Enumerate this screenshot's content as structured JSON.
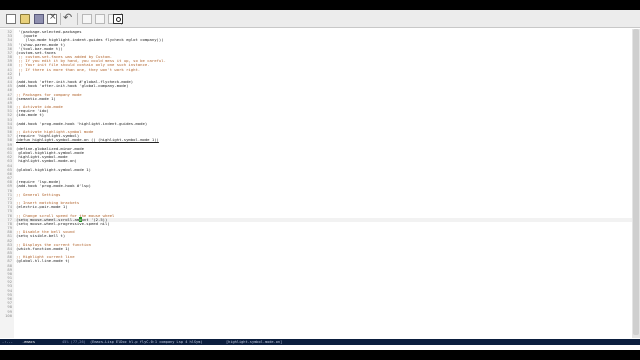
{
  "toolbar": {
    "buttons": [
      {
        "name": "new-file-button",
        "icon": "new-file-icon"
      },
      {
        "name": "open-folder-button",
        "icon": "folder-icon"
      },
      {
        "name": "save-button",
        "icon": "save-icon"
      },
      {
        "name": "close-buffer-button",
        "icon": "close-icon"
      },
      {
        "name": "undo-button",
        "icon": "undo-icon"
      },
      {
        "name": "cut-button",
        "icon": "cut-icon"
      },
      {
        "name": "copy-button",
        "icon": "copy-icon"
      },
      {
        "name": "paste-button",
        "icon": "paste-icon"
      },
      {
        "name": "search-button",
        "icon": "search-icon"
      }
    ]
  },
  "editor": {
    "lines": [
      {
        "n": "32",
        "text": " '(package-selected-packages"
      },
      {
        "n": "33",
        "text": "   (quote"
      },
      {
        "n": "34",
        "text": "    (lsp-mode highlight-indent-guides flycheck eglot company)))"
      },
      {
        "n": "35",
        "text": " '(show-paren-mode t)"
      },
      {
        "n": "36",
        "text": " '(tool-bar-mode t))"
      },
      {
        "n": "37",
        "text": "(custom-set-faces"
      },
      {
        "n": "38",
        "text": " ;; custom-set-faces was added by Custom.",
        "cls": "comment"
      },
      {
        "n": "39",
        "text": " ;; If you edit it by hand, you could mess it up, so be careful.",
        "cls": "comment"
      },
      {
        "n": "40",
        "text": " ;; Your init file should contain only one such instance.",
        "cls": "comment"
      },
      {
        "n": "41",
        "text": " ;; If there is more than one, they won't work right.",
        "cls": "comment"
      },
      {
        "n": "42",
        "text": " )"
      },
      {
        "n": "43",
        "text": ""
      },
      {
        "n": "44",
        "text": "(add-hook 'after-init-hook #'global-flycheck-mode)"
      },
      {
        "n": "45",
        "text": "(add-hook 'after-init-hook 'global-company-mode)"
      },
      {
        "n": "46",
        "text": ""
      },
      {
        "n": "47",
        "text": ";; Packages for company mode",
        "cls": "comment"
      },
      {
        "n": "48",
        "text": "(semantic-mode 1)"
      },
      {
        "n": "49",
        "text": ""
      },
      {
        "n": "50",
        "text": ";; Activate ido-mode",
        "cls": "comment"
      },
      {
        "n": "51",
        "text": "(require 'ido)"
      },
      {
        "n": "52",
        "text": "(ido-mode t)"
      },
      {
        "n": "53",
        "text": ""
      },
      {
        "n": "54",
        "text": "(add-hook 'prog-mode-hook 'highlight-indent-guides-mode)"
      },
      {
        "n": "55",
        "text": ""
      },
      {
        "n": "56",
        "text": ";; Activate highlight-symbol mode",
        "cls": "comment"
      },
      {
        "n": "57",
        "text": "(require 'highlight-symbol)"
      },
      {
        "n": "58",
        "text": "(defun highlight-symbol-mode-on () (highlight-symbol-mode 1))",
        "cls": "highlight-symbol"
      },
      {
        "n": "59",
        "text": ""
      },
      {
        "n": "60",
        "text": "(define-globalized-minor-mode"
      },
      {
        "n": "61",
        "text": " global-highlight-symbol-mode"
      },
      {
        "n": "62",
        "text": " highlight-symbol-mode"
      },
      {
        "n": "63",
        "text": " highlight-symbol-mode-on)"
      },
      {
        "n": "64",
        "text": ""
      },
      {
        "n": "65",
        "text": "(global-highlight-symbol-mode 1)"
      },
      {
        "n": "66",
        "text": ""
      },
      {
        "n": "67",
        "text": ""
      },
      {
        "n": "68",
        "text": "(require 'lsp-mode)"
      },
      {
        "n": "69",
        "text": "(add-hook 'prog-mode-hook #'lsp)"
      },
      {
        "n": "70",
        "text": ""
      },
      {
        "n": "71",
        "text": ";; General Settings",
        "cls": "comment"
      },
      {
        "n": "72",
        "text": ""
      },
      {
        "n": "73",
        "text": ";; Insert matching brackets",
        "cls": "comment"
      },
      {
        "n": "74",
        "text": "(electric-pair-mode 1)"
      },
      {
        "n": "75",
        "text": ""
      },
      {
        "n": "76",
        "text": ";; Change scroll speed for the mouse wheel",
        "cls": "comment"
      },
      {
        "n": "77",
        "text": "(setq mouse-wheel-scroll-amount '(2.5))",
        "cursor": true
      },
      {
        "n": "78",
        "text": "(setq mouse-wheel-progressive-speed nil)"
      },
      {
        "n": "79",
        "text": ""
      },
      {
        "n": "80",
        "text": ";; Disable the bell sound",
        "cls": "comment"
      },
      {
        "n": "81",
        "text": "(setq visible-bell t)"
      },
      {
        "n": "82",
        "text": ""
      },
      {
        "n": "83",
        "text": ";; Displays the current function",
        "cls": "comment"
      },
      {
        "n": "84",
        "text": "(which-function-mode 1)"
      },
      {
        "n": "85",
        "text": ""
      },
      {
        "n": "86",
        "text": ";; Highlight current line",
        "cls": "comment"
      },
      {
        "n": "87",
        "text": "(global-hl-line-mode t)"
      },
      {
        "n": "88",
        "text": ""
      },
      {
        "n": "89",
        "text": ""
      },
      {
        "n": "90",
        "text": ""
      },
      {
        "n": "91",
        "text": ""
      },
      {
        "n": "92",
        "text": ""
      },
      {
        "n": "93",
        "text": ""
      },
      {
        "n": "94",
        "text": ""
      },
      {
        "n": "95",
        "text": ""
      },
      {
        "n": "96",
        "text": ""
      },
      {
        "n": "97",
        "text": ""
      },
      {
        "n": "98",
        "text": ""
      },
      {
        "n": "99",
        "text": ""
      },
      {
        "n": "100",
        "text": ""
      }
    ]
  },
  "modeline": {
    "status": "-:---",
    "buffer": ".emacs",
    "position": "45% (77,26)",
    "modes": "(Emacs-Lisp ElDoc hl-p flyC-0:1 company Lsp 4 hlSym)",
    "function": "[highlight-symbol-mode-on]"
  },
  "colors": {
    "comment": "#b0622a",
    "modeline_bg": "#0b1e3e",
    "cursor": "#1f8f1f"
  }
}
